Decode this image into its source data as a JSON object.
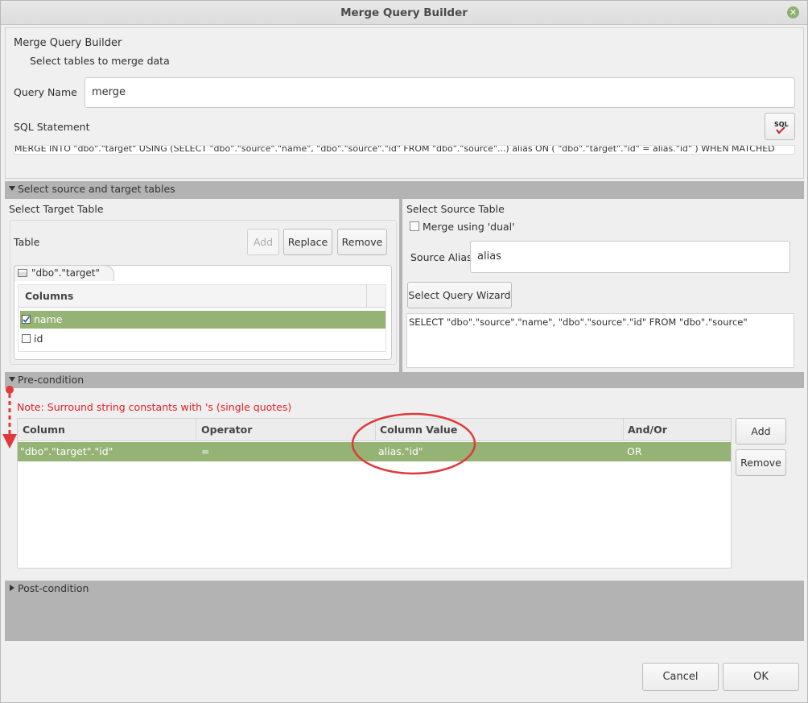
{
  "window": {
    "title": "Merge Query Builder"
  },
  "header": {
    "title": "Merge Query Builder",
    "subtitle": "Select tables to merge data",
    "query_name_label": "Query Name",
    "query_name_value": "merge",
    "sql_label": "SQL Statement",
    "sql_button_label": "SQL",
    "sql_text": "MERGE INTO \"dbo\".\"target\" USING (SELECT \"dbo\".\"source\".\"name\", \"dbo\".\"source\".\"id\" FROM \"dbo\".\"source\"...) alias ON ( \"dbo\".\"target\".\"id\" = alias.\"id\" ) WHEN MATCHED"
  },
  "sections": {
    "source_target": "Select source and target tables",
    "precondition": "Pre-condition",
    "postcondition": "Post-condition"
  },
  "target": {
    "title": "Select Target Table",
    "table_label": "Table",
    "add_label": "Add",
    "replace_label": "Replace",
    "remove_label": "Remove",
    "tab_label": "\"dbo\".\"target\"",
    "columns_header": "Columns",
    "columns": [
      {
        "name": "name",
        "checked": true
      },
      {
        "name": "id",
        "checked": false
      }
    ]
  },
  "source": {
    "title": "Select Source Table",
    "dual_label": "Merge using 'dual'",
    "alias_label": "Source Alias",
    "alias_value": "alias",
    "wizard_label": "Select Query Wizard",
    "query_text": "SELECT \"dbo\".\"source\".\"name\", \"dbo\".\"source\".\"id\" FROM \"dbo\".\"source\""
  },
  "precondition": {
    "note": "Note: Surround string constants with 's (single quotes)",
    "headers": [
      "Column",
      "Operator",
      "Column Value",
      "And/Or"
    ],
    "rows": [
      {
        "column": "\"dbo\".\"target\".\"id\"",
        "operator": "=",
        "value": "alias.\"id\"",
        "andor": "OR"
      }
    ],
    "add_label": "Add",
    "remove_label": "Remove"
  },
  "footer": {
    "cancel_label": "Cancel",
    "ok_label": "OK"
  },
  "colors": {
    "selection": "#94b374",
    "annotation": "#e0393b",
    "section_bg": "#b3b3b3"
  }
}
